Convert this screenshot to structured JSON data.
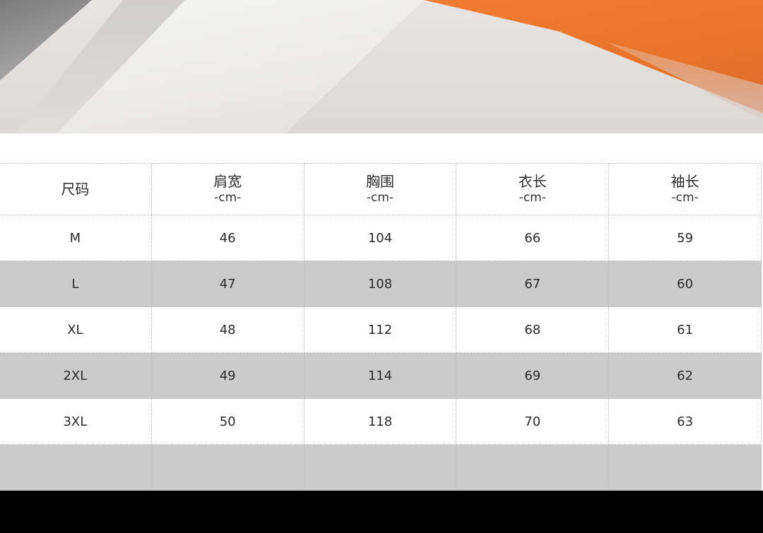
{
  "photo": {
    "description_icon": "product-photo"
  },
  "table": {
    "headers": [
      {
        "name": "尺码",
        "unit": ""
      },
      {
        "name": "肩宽",
        "unit": "-cm-"
      },
      {
        "name": "胸围",
        "unit": "-cm-"
      },
      {
        "name": "衣长",
        "unit": "-cm-"
      },
      {
        "name": "袖长",
        "unit": "-cm-"
      }
    ],
    "rows": [
      [
        "M",
        "46",
        "104",
        "66",
        "59"
      ],
      [
        "L",
        "47",
        "108",
        "67",
        "60"
      ],
      [
        "XL",
        "48",
        "112",
        "68",
        "61"
      ],
      [
        "2XL",
        "49",
        "114",
        "69",
        "62"
      ],
      [
        "3XL",
        "50",
        "118",
        "70",
        "63"
      ]
    ]
  },
  "colors": {
    "row_alt": "#cbcbcb",
    "row_base": "#ffffff",
    "accent_orange": "#f07b32"
  }
}
